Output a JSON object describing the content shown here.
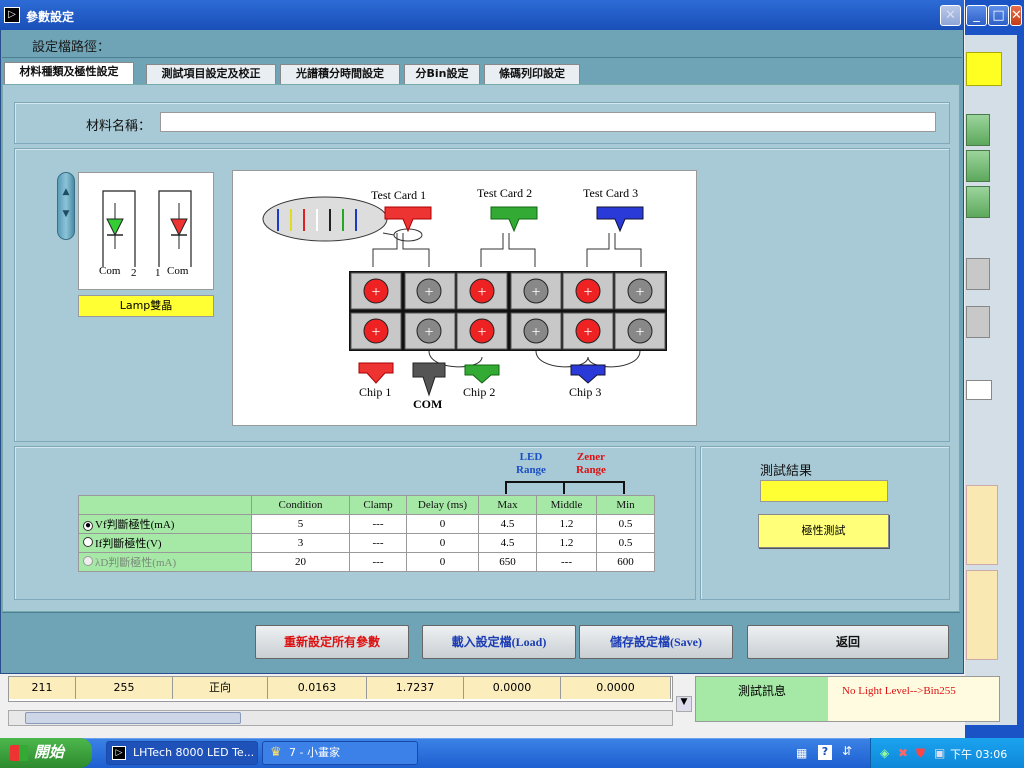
{
  "window": {
    "title": "參數設定",
    "title_icon": "▷"
  },
  "path_label": "設定檔路徑：",
  "tabs": [
    {
      "label": "材料種類及極性設定"
    },
    {
      "label": "測試項目設定及校正"
    },
    {
      "label": "光譜積分時間設定"
    },
    {
      "label": "分Bin設定"
    },
    {
      "label": "條碼列印設定"
    }
  ],
  "material": {
    "label": "材料名稱：",
    "value": ""
  },
  "lamp": {
    "label": "Lamp雙晶",
    "left_com": "Com",
    "left_num": "2",
    "right_num": "1",
    "right_com": "Com"
  },
  "diagram": {
    "cards": [
      "Test Card 1",
      "Test Card 2",
      "Test Card 3"
    ],
    "chips": [
      "Chip 1",
      "COM",
      "Chip 2",
      "Chip 3"
    ]
  },
  "ranges": {
    "led": "LED\nRange",
    "zener": "Zener\nRange"
  },
  "table": {
    "headers": [
      "",
      "Condition",
      "Clamp",
      "Delay (ms)",
      "Max",
      "Middle",
      "Min"
    ],
    "rows": [
      {
        "label": "Vf判斷極性(mA)",
        "selected": true,
        "enabled": true,
        "cells": [
          "5",
          "---",
          "0",
          "4.5",
          "1.2",
          "0.5"
        ]
      },
      {
        "label": "If判斷極性(V)",
        "selected": false,
        "enabled": true,
        "cells": [
          "3",
          "---",
          "0",
          "4.5",
          "1.2",
          "0.5"
        ]
      },
      {
        "label": "λD判斷極性(mA)",
        "selected": false,
        "enabled": false,
        "cells": [
          "20",
          "---",
          "0",
          "650",
          "---",
          "600"
        ]
      }
    ]
  },
  "result": {
    "label": "測試結果",
    "value": "",
    "button": "極性測試"
  },
  "buttons": {
    "reset": "重新設定所有參數",
    "load": "載入設定檔(Load)",
    "save": "儲存設定檔(Save)",
    "back": "返回"
  },
  "background": {
    "row": [
      "211",
      "255",
      "正向",
      "0.0163",
      "1.7237",
      "0.0000",
      "0.0000"
    ],
    "status_label": "測試訊息",
    "status_value": "No Light Level-->Bin255"
  },
  "taskbar": {
    "start": "開始",
    "tasks": [
      "LHTech 8000 LED Te...",
      "7 - 小畫家"
    ],
    "clock": "下午 03:06"
  },
  "colors": {
    "panel": "#a8cad6",
    "title": "#1a4fb8",
    "highlight": "#ffff33",
    "table_header": "#a6e8a6"
  }
}
